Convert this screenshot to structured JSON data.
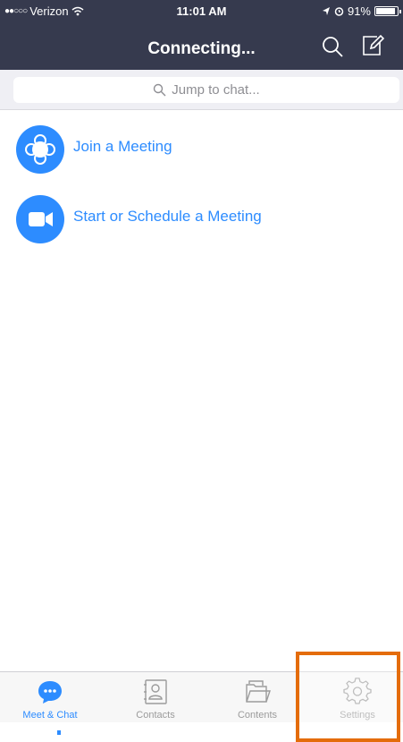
{
  "status_bar": {
    "signal_dots": "●●○○○",
    "carrier": "Verizon",
    "time": "11:01 AM",
    "battery_percent": "91%",
    "battery_level": 0.91
  },
  "nav": {
    "title": "Connecting..."
  },
  "search": {
    "placeholder": "Jump to chat..."
  },
  "menu": {
    "join_label": "Join a Meeting",
    "start_label": "Start or Schedule a Meeting"
  },
  "tabs": [
    {
      "label": "Meet & Chat",
      "icon": "chat-bubble-icon",
      "active": true
    },
    {
      "label": "Contacts",
      "icon": "contacts-icon",
      "active": false
    },
    {
      "label": "Contents",
      "icon": "folder-icon",
      "active": false
    },
    {
      "label": "Settings",
      "icon": "gear-icon",
      "active": false
    }
  ],
  "colors": {
    "header_bg": "#363a4e",
    "accent": "#2d8cff",
    "highlight": "#e46c0a",
    "tab_inactive": "#9b9b9b"
  }
}
